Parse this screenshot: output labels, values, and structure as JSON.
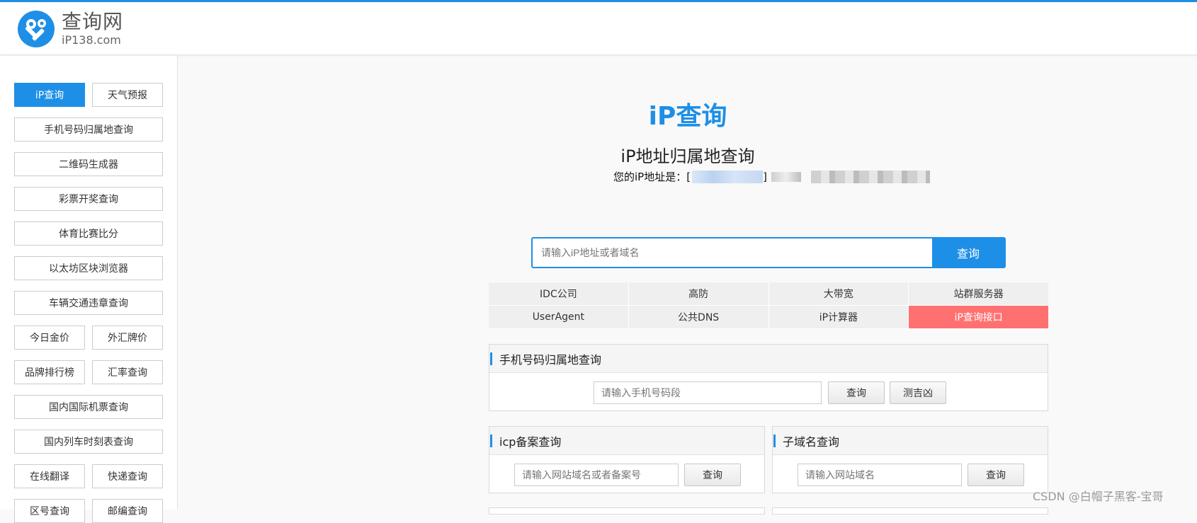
{
  "header": {
    "logo_title": "查询网",
    "logo_subtitle": "iP138.com"
  },
  "sidebar": {
    "items": [
      {
        "label": "iP查询",
        "active": true
      },
      {
        "label": "天气预报"
      },
      {
        "label": "手机号码归属地查询"
      },
      {
        "label": "二维码生成器"
      },
      {
        "label": "彩票开奖查询"
      },
      {
        "label": "体育比赛比分"
      },
      {
        "label": "以太坊区块浏览器"
      },
      {
        "label": "车辆交通违章查询"
      },
      {
        "label": "今日金价"
      },
      {
        "label": "外汇牌价"
      },
      {
        "label": "品牌排行榜"
      },
      {
        "label": "汇率查询"
      },
      {
        "label": "国内国际机票查询"
      },
      {
        "label": "国内列车时刻表查询"
      },
      {
        "label": "在线翻译"
      },
      {
        "label": "快递查询"
      },
      {
        "label": "区号查询"
      },
      {
        "label": "邮编查询"
      }
    ]
  },
  "main": {
    "title": "iP查询",
    "subtitle": "iP地址归属地查询",
    "ip_label": "您的iP地址是：[",
    "ip_close": "]",
    "search": {
      "placeholder": "请输入iP地址或者域名",
      "button": "查询"
    },
    "quick_links": [
      {
        "label": "IDC公司"
      },
      {
        "label": "高防"
      },
      {
        "label": "大带宽"
      },
      {
        "label": "站群服务器"
      },
      {
        "label": "UserAgent"
      },
      {
        "label": "公共DNS"
      },
      {
        "label": "iP计算器"
      },
      {
        "label": "iP查询接口",
        "highlight": true
      }
    ],
    "phone_panel": {
      "title": "手机号码归属地查询",
      "placeholder": "请输入手机号码段",
      "query_button": "查询",
      "fortune_button": "测吉凶"
    },
    "icp_panel": {
      "title": "icp备案查询",
      "placeholder": "请输入网站域名或者备案号",
      "query_button": "查询"
    },
    "subdomain_panel": {
      "title": "子域名查询",
      "placeholder": "请输入网站域名",
      "query_button": "查询"
    }
  },
  "watermark": "CSDN @白帽子黑客-宝哥",
  "colors": {
    "accent": "#1e8fe6",
    "highlight": "#ff7070"
  }
}
